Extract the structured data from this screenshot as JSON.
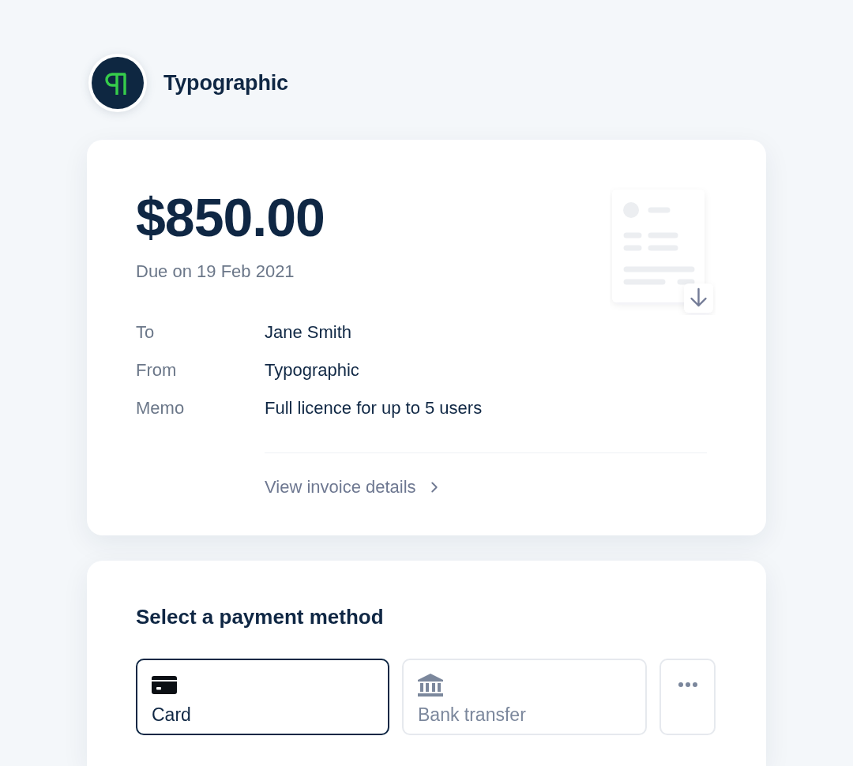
{
  "header": {
    "brand_name": "Typographic"
  },
  "invoice": {
    "amount": "$850.00",
    "due_date": "Due on 19 Feb 2021",
    "details": [
      {
        "label": "To",
        "value": "Jane Smith"
      },
      {
        "label": "From",
        "value": "Typographic"
      },
      {
        "label": "Memo",
        "value": "Full licence for up to 5 users"
      }
    ],
    "details_link": "View invoice details"
  },
  "payment": {
    "title": "Select a payment method",
    "methods": [
      {
        "kind": "card",
        "label": "Card",
        "selected": true
      },
      {
        "kind": "bank",
        "label": "Bank transfer",
        "selected": false
      },
      {
        "kind": "more",
        "selected": false
      }
    ]
  }
}
